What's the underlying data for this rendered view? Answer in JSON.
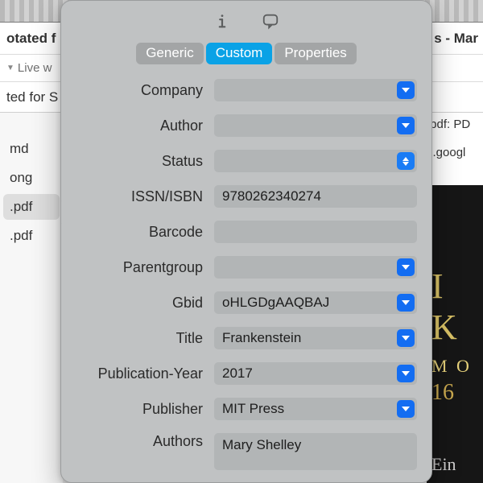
{
  "background": {
    "title_left": "otated f",
    "title_right": "s - Mar",
    "breadcrumb_left": "Live w",
    "subtitle_left": "ted for S",
    "subtitle_right_1": ".pdf: PD",
    "subtitle_right_2": "s.googl",
    "sidebar_items": [
      "md",
      "ong",
      ".pdf",
      ".pdf"
    ],
    "sidebar_selected_index": 2,
    "book_big": "I K",
    "book_mid": "M O",
    "book_num": "16",
    "book_ein": "Ein"
  },
  "panel": {
    "tabs": [
      "Generic",
      "Custom",
      "Properties"
    ],
    "active_tab_index": 1,
    "fields": [
      {
        "label": "Company",
        "value": "",
        "control": "chevron"
      },
      {
        "label": "Author",
        "value": "",
        "control": "chevron"
      },
      {
        "label": "Status",
        "value": "",
        "control": "updown"
      },
      {
        "label": "ISSN/ISBN",
        "value": "9780262340274",
        "control": "none"
      },
      {
        "label": "Barcode",
        "value": "",
        "control": "none"
      },
      {
        "label": "Parentgroup",
        "value": "",
        "control": "chevron"
      },
      {
        "label": "Gbid",
        "value": "oHLGDgAAQBAJ",
        "control": "chevron"
      },
      {
        "label": "Title",
        "value": "Frankenstein",
        "control": "chevron"
      },
      {
        "label": "Publication-Year",
        "value": "2017",
        "control": "chevron"
      },
      {
        "label": "Publisher",
        "value": "MIT Press",
        "control": "chevron"
      },
      {
        "label": "Authors",
        "value": "Mary Shelley",
        "control": "none",
        "textarea": true
      }
    ]
  }
}
